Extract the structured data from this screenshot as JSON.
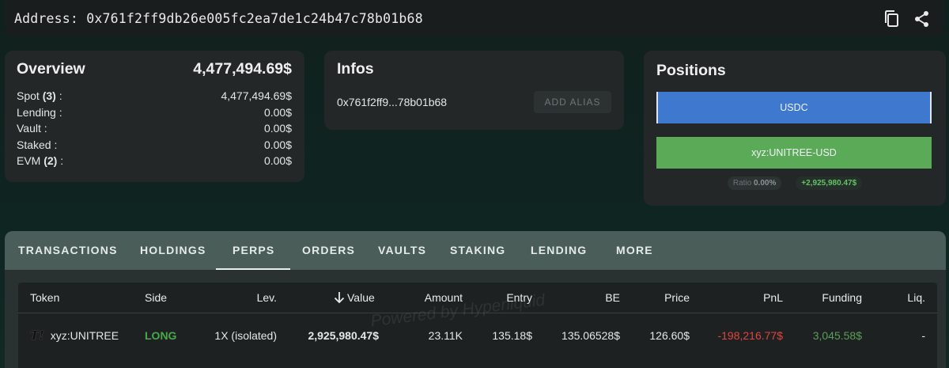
{
  "address_bar": {
    "label": "Address: 0x761f2ff9db26e005fc2ea7de1c24b47c78b01b68",
    "copy_icon": "copy-icon",
    "share_icon": "share-icon"
  },
  "overview": {
    "title": "Overview",
    "total": "4,477,494.69$",
    "rows": [
      {
        "label": "Spot",
        "count": "(3)",
        "suffix": " :",
        "value": "4,477,494.69$"
      },
      {
        "label": "Lending :",
        "count": "",
        "suffix": "",
        "value": "0.00$"
      },
      {
        "label": "Vault :",
        "count": "",
        "suffix": "",
        "value": "0.00$"
      },
      {
        "label": "Staked :",
        "count": "",
        "suffix": "",
        "value": "0.00$"
      },
      {
        "label": "EVM",
        "count": "(2)",
        "suffix": " :",
        "value": "0.00$"
      }
    ]
  },
  "infos": {
    "title": "Infos",
    "short_address": "0x761f2ff9...78b01b68",
    "alias_button": "ADD ALIAS"
  },
  "positions": {
    "title": "Positions",
    "bars": [
      {
        "label": "USDC",
        "color": "#3f78cf"
      },
      {
        "label": "xyz:UNITREE-USD",
        "color": "#5aaa58"
      }
    ],
    "ratio_label": "Ratio",
    "ratio_value": "0.00%",
    "pnl": "+2,925,980.47$"
  },
  "tabs": {
    "items": [
      "TRANSACTIONS",
      "HOLDINGS",
      "PERPS",
      "ORDERS",
      "VAULTS",
      "STAKING",
      "LENDING",
      "MORE"
    ],
    "active": "PERPS"
  },
  "table": {
    "headers": {
      "token": "Token",
      "side": "Side",
      "lev": "Lev.",
      "value": "Value",
      "amount": "Amount",
      "entry": "Entry",
      "be": "BE",
      "price": "Price",
      "pnl": "PnL",
      "funding": "Funding",
      "liq": "Liq."
    },
    "sort_icon": "arrow-down-icon",
    "rows": [
      {
        "token": "xyz:UNITREE",
        "side": "LONG",
        "lev": "1X (isolated)",
        "value": "2,925,980.47$",
        "amount": "23.11K",
        "entry": "135.18$",
        "be": "135.06528$",
        "price": "126.60$",
        "pnl": "-198,216.77$",
        "funding": "3,045.58$",
        "liq": "-"
      }
    ]
  },
  "watermark": "Powered by Hyperliquid"
}
